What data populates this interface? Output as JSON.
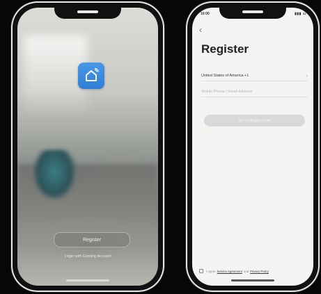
{
  "welcome_screen": {
    "app_icon": "home-app-icon",
    "register_button": "Register",
    "login_link": "Login with Existing Account"
  },
  "register_screen": {
    "status_time": "10:00",
    "status_icons": "▮▮▮ ▭",
    "back_icon": "chevron-left-icon",
    "title": "Register",
    "country_value": "United States of America +1",
    "phone_placeholder": "Mobile Phone / Email Address",
    "get_code_button": "Get Verification Code",
    "agreement": {
      "prefix": "I Agree",
      "service_link": "Service Agreement",
      "and": "and",
      "privacy_link": "Privacy Policy"
    }
  },
  "colors": {
    "app_icon_blue": "#2f7fd6",
    "register_bg": "#f4f4f3",
    "disabled_button": "#d9d9dc"
  }
}
